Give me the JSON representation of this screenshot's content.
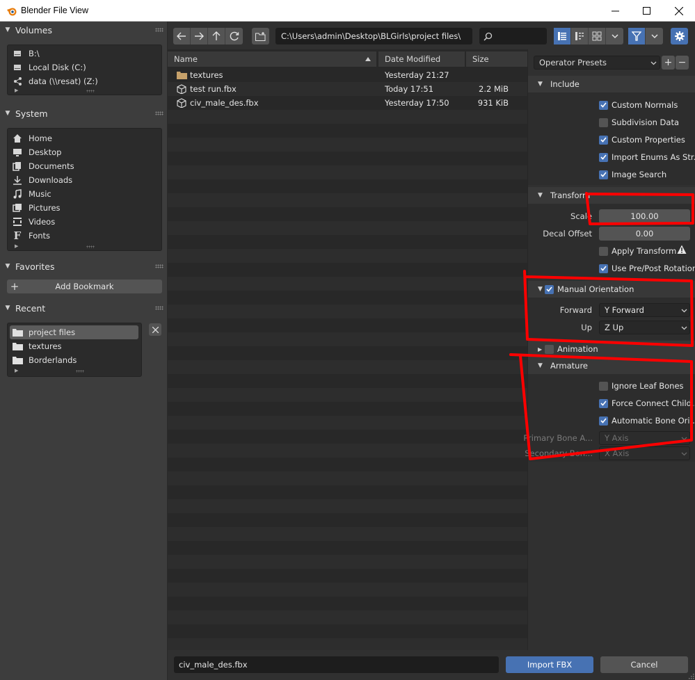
{
  "window": {
    "title": "Blender File View"
  },
  "sidebar": {
    "volumes": {
      "label": "Volumes",
      "items": [
        {
          "label": "B:\\",
          "icon": "drive-icon"
        },
        {
          "label": "Local Disk (C:)",
          "icon": "drive-icon"
        },
        {
          "label": "data (\\\\resat) (Z:)",
          "icon": "network-drive-icon"
        }
      ]
    },
    "system": {
      "label": "System",
      "items": [
        {
          "label": "Home",
          "icon": "home-icon"
        },
        {
          "label": "Desktop",
          "icon": "desktop-icon"
        },
        {
          "label": "Documents",
          "icon": "documents-icon"
        },
        {
          "label": "Downloads",
          "icon": "downloads-icon"
        },
        {
          "label": "Music",
          "icon": "music-icon"
        },
        {
          "label": "Pictures",
          "icon": "pictures-icon"
        },
        {
          "label": "Videos",
          "icon": "videos-icon"
        },
        {
          "label": "Fonts",
          "icon": "fonts-icon"
        }
      ]
    },
    "favorites": {
      "label": "Favorites",
      "add_bookmark": "Add Bookmark"
    },
    "recent": {
      "label": "Recent",
      "items": [
        {
          "label": "project files",
          "selected": true
        },
        {
          "label": "textures",
          "selected": false
        },
        {
          "label": "Borderlands",
          "selected": false
        }
      ]
    }
  },
  "toolbar": {
    "path": "C:\\Users\\admin\\Desktop\\BLGirls\\project files\\",
    "search_value": ""
  },
  "filelist": {
    "columns": {
      "name": "Name",
      "date": "Date Modified",
      "size": "Size"
    },
    "files": [
      {
        "name": "textures",
        "type": "folder",
        "date": "Yesterday 21:27",
        "size": ""
      },
      {
        "name": "test run.fbx",
        "type": "file",
        "date": "Today 17:51",
        "size": "2.2 MiB"
      },
      {
        "name": "civ_male_des.fbx",
        "type": "file",
        "date": "Yesterday 17:50",
        "size": "931 KiB"
      }
    ]
  },
  "props": {
    "operator_presets": "Operator Presets",
    "include": {
      "label": "Include",
      "options": [
        {
          "label": "Custom Normals",
          "checked": true
        },
        {
          "label": "Subdivision Data",
          "checked": false
        },
        {
          "label": "Custom Properties",
          "checked": true
        },
        {
          "label": "Import Enums As Str...",
          "checked": true
        },
        {
          "label": "Image Search",
          "checked": true
        }
      ]
    },
    "transform": {
      "label": "Transform",
      "scale_label": "Scale",
      "scale_value": "100.00",
      "decal_label": "Decal Offset",
      "decal_value": "0.00",
      "apply_transform": "Apply Transform",
      "use_prepost": "Use Pre/Post Rotation",
      "manual_orientation": "Manual Orientation",
      "forward_label": "Forward",
      "forward_value": "Y Forward",
      "up_label": "Up",
      "up_value": "Z Up"
    },
    "animation": {
      "label": "Animation"
    },
    "armature": {
      "label": "Armature",
      "ignore_leaf": "Ignore Leaf Bones",
      "force_connect": "Force Connect Child...",
      "auto_bone": "Automatic Bone Ori...",
      "primary_label": "Primary Bone A...",
      "primary_value": "Y Axis",
      "secondary_label": "Secondary Bon...",
      "secondary_value": "X Axis"
    }
  },
  "bottom": {
    "filename": "civ_male_des.fbx",
    "import_label": "Import FBX",
    "cancel_label": "Cancel"
  },
  "colors": {
    "accent": "#4772b3",
    "annotation": "#ff0000"
  }
}
